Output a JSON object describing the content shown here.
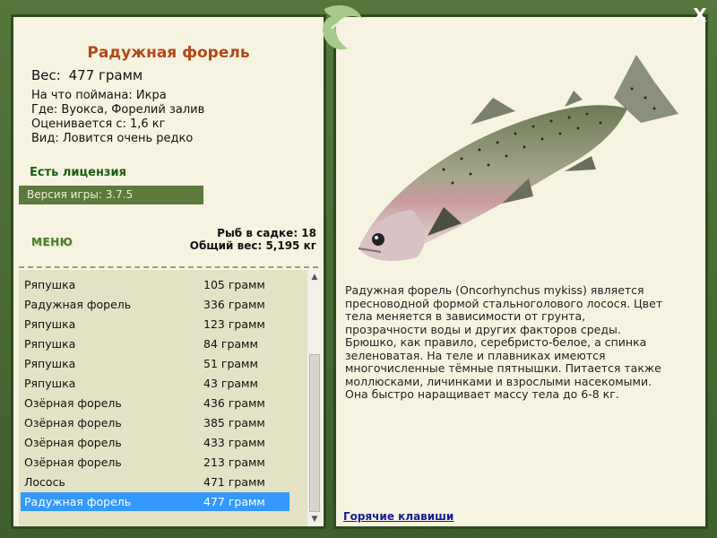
{
  "fish": {
    "title": "Радужная форель",
    "weight_label": "Вес:",
    "weight_value": "477 грамм",
    "bait": "На что поймана: Икра",
    "location": "Где: Вуокса, Форелий залив",
    "value": "Оценивается с: 1,6 кг",
    "rarity": "Вид: Ловится очень редко"
  },
  "license": "Есть лицензия",
  "version": "Версия игры: 3.7.5",
  "menu_label": "МЕНЮ",
  "stats": {
    "count": "Рыб в садке: 18",
    "total": "Общий вес: 5,195 кг"
  },
  "catch_list": [
    {
      "name": "Ряпушка",
      "weight": "105 грамм"
    },
    {
      "name": "Радужная форель",
      "weight": "336 грамм"
    },
    {
      "name": "Ряпушка",
      "weight": "123 грамм"
    },
    {
      "name": "Ряпушка",
      "weight": "84 грамм"
    },
    {
      "name": "Ряпушка",
      "weight": "51 грамм"
    },
    {
      "name": "Ряпушка",
      "weight": "43 грамм"
    },
    {
      "name": "Озёрная форель",
      "weight": "436 грамм"
    },
    {
      "name": "Озёрная форель",
      "weight": "385 грамм"
    },
    {
      "name": "Озёрная форель",
      "weight": "433 грамм"
    },
    {
      "name": "Озёрная форель",
      "weight": "213 грамм"
    },
    {
      "name": "Лосось",
      "weight": "471 грамм"
    },
    {
      "name": "Радужная форель",
      "weight": "477 грамм"
    }
  ],
  "description": "Радужная форель (Oncorhynchus mykiss) является пресноводной формой стальноголового лосося. Цвет тела меняется в зависимости от грунта, прозрачности воды и других факторов среды. Брюшко, как правило, серебристо-белое, а спинка зеленоватая. На теле и плавниках имеются многочисленные тёмные пятнышки. Питается также моллюсками, личинками и взрослыми насекомыми. Она быстро наращивает массу тела до 6-8 кг.",
  "hotkeys_label": "Горячие клавиши",
  "close_label": "X",
  "icons": {
    "close": "close-icon",
    "logo": "dolphin-logo-icon",
    "scroll_up": "arrow-up-icon",
    "scroll_down": "arrow-down-icon"
  }
}
